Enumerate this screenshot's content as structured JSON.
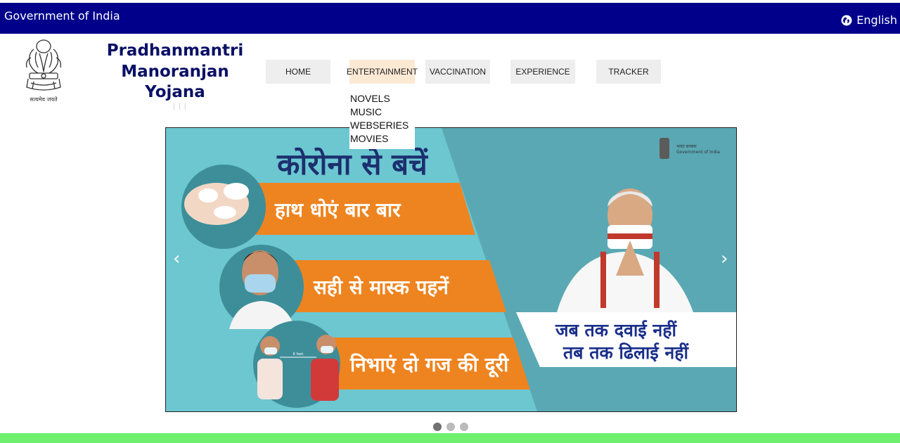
{
  "header": {
    "gov_title": "Government of India",
    "language_label": "English",
    "language_icon": "globe-icon",
    "bar_color": "#00008b"
  },
  "brand": {
    "line1": "Pradhanmantri",
    "line2": "Manoranjan",
    "line3": "Yojana",
    "sub": "| | |",
    "emblem_caption": "सत्यमेव जयते",
    "text_color": "#0a1065"
  },
  "nav": {
    "items": [
      {
        "label": "HOME"
      },
      {
        "label": "ENTERTAINMENT"
      },
      {
        "label": "VACCINATION"
      },
      {
        "label": "EXPERIENCE"
      },
      {
        "label": "TRACKER"
      }
    ],
    "active_index": 1,
    "dropdown": [
      "NOVELS",
      "MUSIC",
      "WEBSERIES",
      "MOVIES"
    ]
  },
  "carousel": {
    "slide_title": "कोरोना से बचें",
    "tips": [
      "हाथ धोएं बार बार",
      "सही से मास्क पहनें",
      "निभाएं दो गज की दूरी"
    ],
    "distance_label": "6 feet",
    "gov_logo_hindi": "भारत सरकार",
    "gov_logo_english": "Government of India",
    "slogan_line1": "जब तक दवाई नहीं",
    "slogan_line2": "तब तक ढिलाई नहीं",
    "prev_label": "‹",
    "next_label": "›",
    "slide_count": 3,
    "active_slide": 1,
    "colors": {
      "teal_light": "#6cc7d1",
      "teal_dark": "#5aa8b4",
      "orange": "#ee8420",
      "title_blue": "#1c2f6e",
      "slogan_blue": "#1a2f8a"
    }
  },
  "footer": {
    "bar_color": "#6ef06e"
  }
}
